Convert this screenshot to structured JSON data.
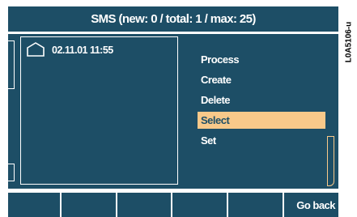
{
  "header": {
    "title": "SMS (new: 0 / total: 1 / max: 25)"
  },
  "message_list": {
    "items": [
      {
        "icon": "envelope-icon",
        "datetime": "02.11.01 11:55"
      }
    ]
  },
  "menu": {
    "items": [
      {
        "label": "Process",
        "selected": false
      },
      {
        "label": "Create",
        "selected": false
      },
      {
        "label": "Delete",
        "selected": false
      },
      {
        "label": "Select",
        "selected": true
      },
      {
        "label": "Set",
        "selected": false
      }
    ]
  },
  "softkeys": [
    "",
    "",
    "",
    "",
    "",
    "Go back"
  ],
  "doc_id": "L0A5106-u",
  "colors": {
    "panel": "#1d4e66",
    "highlight": "#f8c98a",
    "text": "#ffffff"
  }
}
